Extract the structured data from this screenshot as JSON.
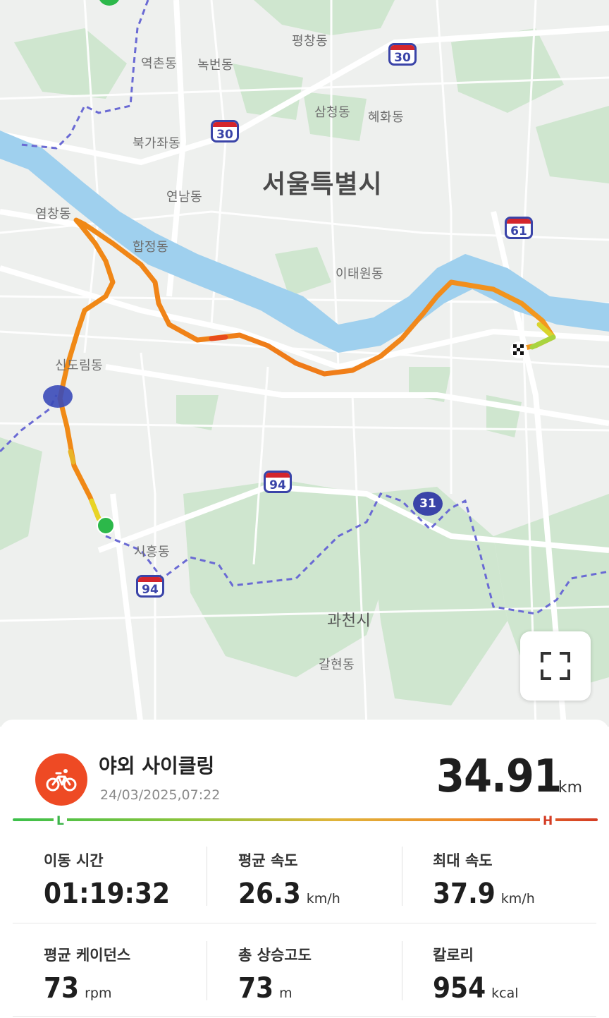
{
  "map": {
    "labels": {
      "pyeongchang": "평창동",
      "yeokchon": "역촌동",
      "nokbeon": "녹번동",
      "samcheong": "삼청동",
      "hyehwa": "혜화동",
      "bukgajwa": "북가좌동",
      "seoul": "서울특별시",
      "yeonnam": "연남동",
      "yeomchang": "염창동",
      "hapjeong": "합정동",
      "itaewon": "이태원동",
      "sindorim": "신도림동",
      "siheung": "시흥동",
      "gwacheon": "과천시",
      "galhyeon": "갈현동"
    },
    "routes": {
      "r30a": "30",
      "r30b": "30",
      "r61": "61",
      "r94a": "94",
      "r31": "31",
      "r94b": "94"
    },
    "expand_icon": "expand-icon"
  },
  "activity": {
    "icon": "bicycle-icon",
    "accent_color": "#ee4a24",
    "title": "야외 사이클링",
    "date": "24/03/2025,07:22",
    "distance": "34.91",
    "distance_unit": "km",
    "scale_low": "L",
    "scale_high": "H"
  },
  "stats": [
    {
      "label": "이동 시간",
      "value": "01:19:32",
      "unit": ""
    },
    {
      "label": "평균 속도",
      "value": "26.3",
      "unit": "km/h"
    },
    {
      "label": "최대 속도",
      "value": "37.9",
      "unit": "km/h"
    },
    {
      "label": "평균 케이던스",
      "value": "73",
      "unit": "rpm"
    },
    {
      "label": "총 상승고도",
      "value": "73",
      "unit": "m"
    },
    {
      "label": "칼로리",
      "value": "954",
      "unit": "kcal"
    }
  ]
}
